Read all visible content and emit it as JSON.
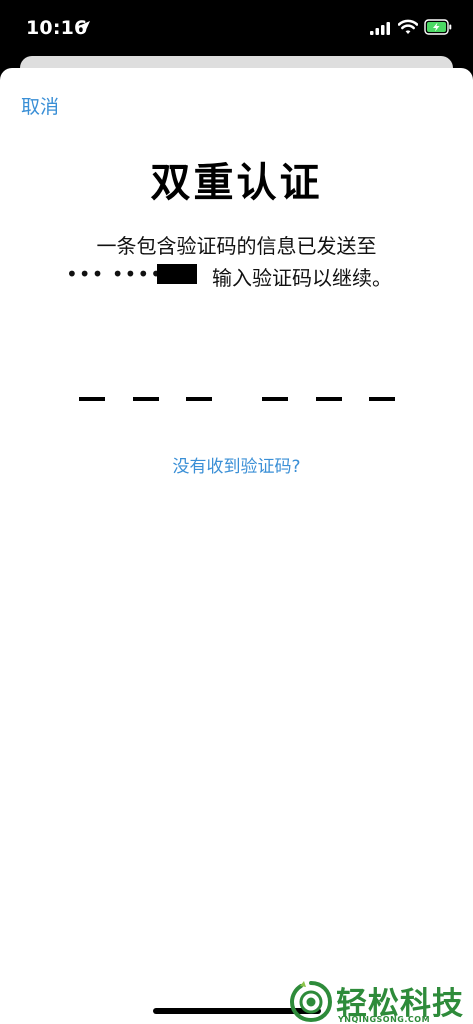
{
  "status_bar": {
    "time": "10:16"
  },
  "header": {
    "cancel_label": "取消"
  },
  "main": {
    "title": "双重认证",
    "message_line1": "一条包含验证码的信息已发送至",
    "masked_number": "••• •••• ••",
    "message_line2": "输入验证码以继续。",
    "code_slots": 6,
    "resend_label": "没有收到验证码?"
  },
  "watermark": {
    "brand": "轻松科技",
    "domain": "YNQINGSONG.COM"
  },
  "colors": {
    "accent": "#3a8fd6",
    "watermark": "#2e8b3a"
  }
}
